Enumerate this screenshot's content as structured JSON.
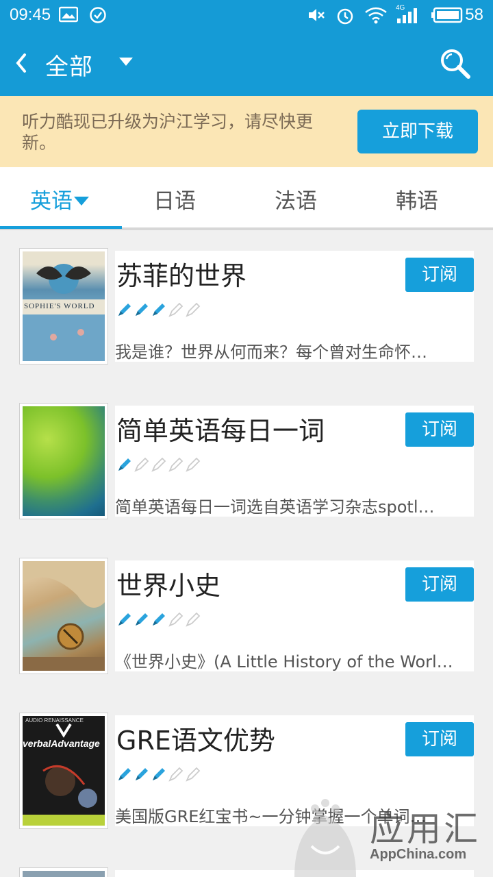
{
  "status_bar": {
    "time": "09:45",
    "battery": "58",
    "network": "4G",
    "icons": [
      "image-icon",
      "check-circle-icon",
      "mute-icon",
      "alarm-icon",
      "wifi-icon",
      "signal-icon",
      "battery-icon"
    ]
  },
  "app_bar": {
    "title": "全部",
    "back_icon": "back-chevron-icon",
    "dropdown_icon": "caret-down-icon",
    "search_icon": "search-icon",
    "background_color": "#159bd6"
  },
  "banner": {
    "text": "听力酷现已升级为沪江学习，请尽快更新。",
    "button_label": "立即下载",
    "background_color": "#fbe6b5"
  },
  "tabs": [
    {
      "label": "英语",
      "active": true
    },
    {
      "label": "日语",
      "active": false
    },
    {
      "label": "法语",
      "active": false
    },
    {
      "label": "韩语",
      "active": false
    }
  ],
  "books": [
    {
      "title": "苏菲的世界",
      "rating": 3,
      "rating_max": 5,
      "description": "我是谁？世界从何而来？每个曾对生命怀…",
      "button_label": "订阅",
      "cover_title": "SOPHIE'S WORLD"
    },
    {
      "title": "简单英语每日一词",
      "rating": 1,
      "rating_max": 5,
      "description": "简单英语每日一词选自英语学习杂志spotl…",
      "button_label": "订阅"
    },
    {
      "title": "世界小史",
      "rating": 3,
      "rating_max": 5,
      "description": "《世界小史》(A Little History of the Worl…",
      "button_label": "订阅"
    },
    {
      "title": "GRE语文优势",
      "rating": 3,
      "rating_max": 5,
      "description": "美国版GRE红宝书~一分钟掌握一个单词…",
      "button_label": "订阅",
      "cover_title": "verbalAdvantage",
      "cover_top": "AUDIO RENAISSANCE"
    }
  ],
  "watermark": {
    "text": "应用汇",
    "subtext": "AppChina.com"
  },
  "colors": {
    "accent": "#169fdb",
    "pencil_filled": "#2aa3dd",
    "pencil_empty": "#cccccc"
  }
}
